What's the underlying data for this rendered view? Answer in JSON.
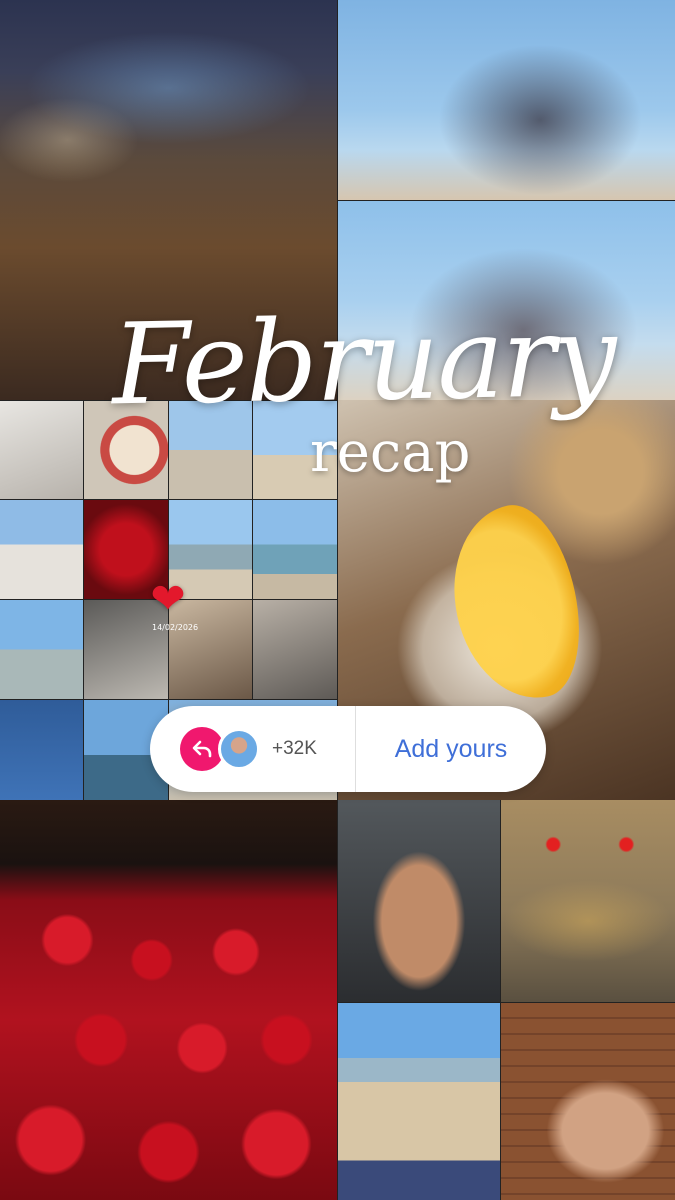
{
  "title": {
    "month": "February",
    "subtitle": "recap"
  },
  "sticker": {
    "heart_icon": "heart-icon",
    "date": "14/02/2026"
  },
  "add_yours": {
    "count": "+32K",
    "button_label": "Add yours",
    "reply_icon": "reply-arrow-icon",
    "accent_color": "#f0186e",
    "button_color": "#3f6fd8"
  }
}
